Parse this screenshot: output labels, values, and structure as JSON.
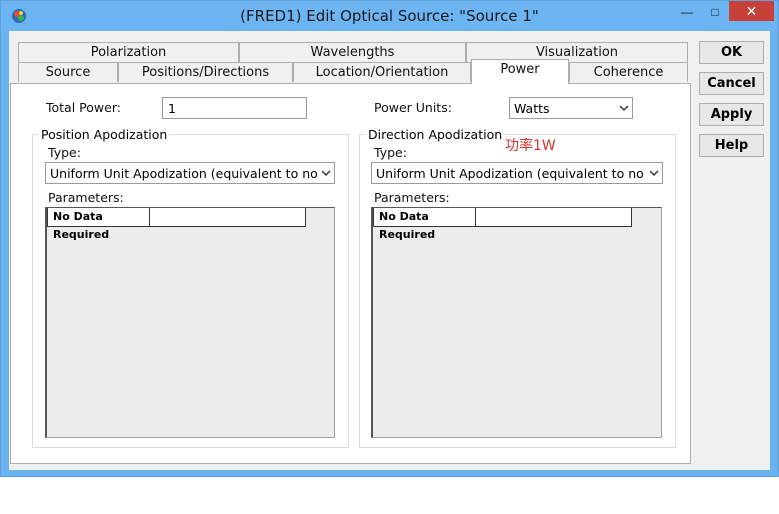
{
  "window": {
    "title": "(FRED1) Edit Optical Source: \"Source 1\"",
    "min_glyph": "—",
    "max_glyph": "□",
    "close_glyph": "✕"
  },
  "tabs": {
    "row1": [
      "Polarization",
      "Wavelengths",
      "Visualization"
    ],
    "row2": [
      "Source",
      "Positions/Directions",
      "Location/Orientation",
      "Power",
      "Coherence"
    ],
    "active": "Power"
  },
  "buttons": {
    "ok": "OK",
    "cancel": "Cancel",
    "apply": "Apply",
    "help": "Help"
  },
  "power": {
    "total_power_label": "Total Power:",
    "total_power_value": "1",
    "power_units_label": "Power Units:",
    "power_units_value": "Watts"
  },
  "position_apodization": {
    "title": "Position Apodization",
    "type_label": "Type:",
    "type_value": "Uniform Unit Apodization (equivalent to no ap",
    "parameters_label": "Parameters:",
    "cell_text": "No Data Required"
  },
  "direction_apodization": {
    "title": "Direction Apodization",
    "type_label": "Type:",
    "type_value": "Uniform Unit Apodization (equivalent to no ap",
    "parameters_label": "Parameters:",
    "cell_text": "No Data Required"
  },
  "annotation": "功率1W",
  "colors": {
    "titlebar": "#6cb4f2",
    "close_button": "#c7403a",
    "annotation": "#d9322e"
  }
}
